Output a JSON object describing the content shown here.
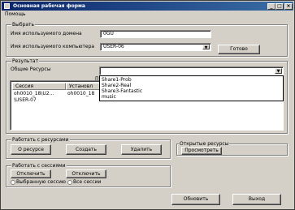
{
  "window": {
    "title": "Основная рабочая форма",
    "minimize": "_",
    "maximize": "□",
    "close": "×"
  },
  "menu": {
    "help": "Помощь"
  },
  "select_group": {
    "title": "Выбрать",
    "domain_label": "Имя используемого домена",
    "domain_value": "0GU",
    "computer_label": "Имя используемого компьютера",
    "computer_value": "USER-06",
    "ok_button": "Готово"
  },
  "result_group": {
    "title": "Результат",
    "shared_label": "Общие Ресурсы",
    "shared_value": "",
    "hidden_label_fragment": "П",
    "dropdown_options": [
      "Share1-Prob",
      "Share2-Real",
      "Share3-Fantastic",
      "music"
    ],
    "columns": [
      "Сессия",
      "Установл"
    ],
    "rows": [
      [
        "oh0010_18\\U2...",
        "oh0010_18",
        "",
        ""
      ],
      [
        "\\USER-07",
        "",
        "USER-07",
        "130",
        "0"
      ]
    ]
  },
  "resources_group": {
    "title": "Работать с ресурсами",
    "about_button": "О ресурсе",
    "create_button": "Создать",
    "delete_button": "Удалить"
  },
  "open_resources_group": {
    "title": "Открытые ресурсы",
    "view_button": "Просмотреть"
  },
  "sessions_group": {
    "title": "Работать с сессиями",
    "disconnect_button_1": "Отключить",
    "disconnect_button_2": "Отключить",
    "selected_session_radio": "Выбранную сессию",
    "all_sessions_radio": "Все сессии"
  },
  "footer": {
    "refresh_button": "Обновить",
    "exit_button": "Выход"
  }
}
